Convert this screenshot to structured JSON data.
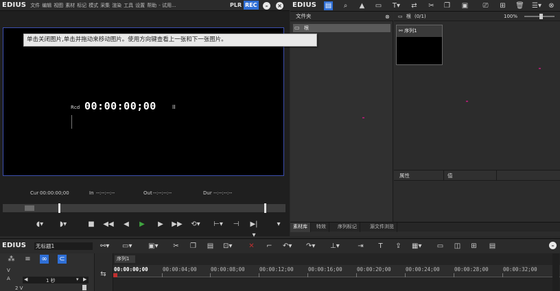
{
  "player": {
    "brand": "EDIUS",
    "menu": [
      "文件",
      "编辑",
      "视图",
      "素材",
      "标记",
      "模式",
      "采集",
      "渲染",
      "工具",
      "设置",
      "帮助",
      "- 试用..."
    ],
    "plr_label": "PLR",
    "rec_label": "REC",
    "tooltip": "单击关闭图片,单击并拖动来移动图片。使用方向键查看上一张和下一张图片。",
    "rcd_label": "Rcd",
    "rcd_time": "00:00:00;00",
    "rcd_mark": "II",
    "cur_label": "Cur",
    "cur_value": "00:00:00;00",
    "in_label": "In",
    "in_value": "--:--:--:--",
    "out_label": "Out",
    "out_value": "--:--:--:--",
    "dur_label": "Dur",
    "dur_value": "--:--:--:--"
  },
  "bin": {
    "brand": "EDIUS",
    "folder_header": "文件夹",
    "root_folder": "根",
    "clip_path": "根",
    "clip_count": "(0/1)",
    "zoom": "100%",
    "clip_name": "序列1",
    "prop_col1": "属性",
    "prop_col2": "值",
    "tabs": [
      "素材库",
      "特效",
      "序列标记",
      "源文件浏览"
    ]
  },
  "timeline": {
    "brand": "EDIUS",
    "project_name": "无标题1",
    "sequence_tab": "序列1",
    "zoom_value": "1 秒",
    "track_v": "V",
    "track_a": "A",
    "track_2v": "2 V",
    "ruler": [
      "00:00:00;00",
      "00:00:04;00",
      "00:00:08;00",
      "00:00:12;00",
      "00:00:16;00",
      "00:00:20;00",
      "00:00:24;00",
      "00:00:28;00",
      "00:00:32;00"
    ]
  },
  "colors": {
    "rec_active": "#2f6fd6",
    "preview_border": "#3c4fb0",
    "dot_marker": "#a0206a"
  }
}
